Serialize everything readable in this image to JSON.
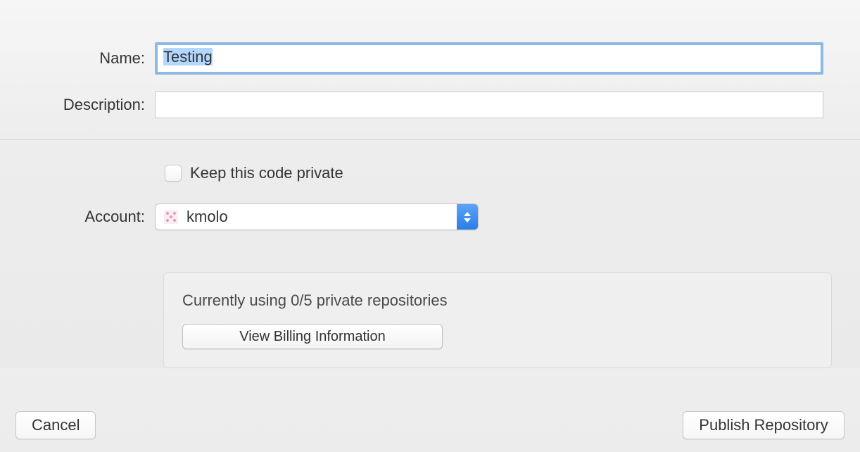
{
  "form": {
    "name_label": "Name:",
    "name_value": "Testing",
    "description_label": "Description:",
    "description_value": ""
  },
  "private": {
    "checkbox_label": "Keep this code private",
    "checked": false
  },
  "account": {
    "label": "Account:",
    "selected": "kmolo"
  },
  "usage": {
    "text": "Currently using 0/5 private repositories",
    "billing_button": "View Billing Information"
  },
  "buttons": {
    "cancel": "Cancel",
    "publish": "Publish Repository"
  }
}
